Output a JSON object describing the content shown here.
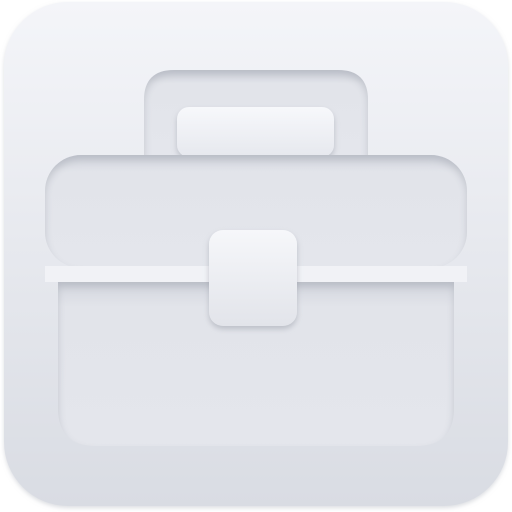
{
  "icon": {
    "name": "briefcase-icon",
    "type": "app-icon",
    "style": "embossed monochrome",
    "colors": {
      "tile_light": "#f3f4f8",
      "tile_dark": "#dcdfe6",
      "recess": "#dadde4",
      "recess_shadow": "#b7bbc5",
      "highlight": "#ffffff",
      "clasp": "#eceef2"
    }
  }
}
